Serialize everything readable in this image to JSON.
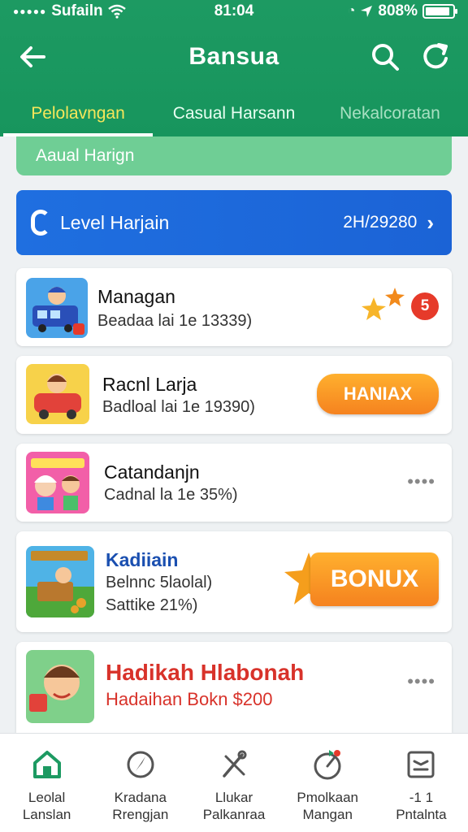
{
  "status": {
    "carrier": "Sufailn",
    "time": "81:04",
    "battery": "808%",
    "battery_level": 0.9
  },
  "header": {
    "title": "Bansua"
  },
  "tabs": [
    {
      "label": "Pelolavngan"
    },
    {
      "label": "Casual Harsann"
    },
    {
      "label": "Nekalcoratan"
    }
  ],
  "subbanner": {
    "label": "Aaual Harign"
  },
  "level": {
    "label": "Level Harjain",
    "code": "2H/29280",
    "chevron": "›"
  },
  "cards": [
    {
      "title": "Managan",
      "subtitle": "Beadaa lai 1e 13339)",
      "badge": "5"
    },
    {
      "title": "Racnl Larja",
      "subtitle": "Badloal lai 1e 19390)",
      "button": "HANIAX"
    },
    {
      "title": "Catandanjn",
      "subtitle": "Cadnal la 1e 35%)",
      "dots": "••••"
    },
    {
      "title": "Kadiiain",
      "subtitle": "Belnnc 5laolal)",
      "subtitle2": "Sattike 21%)",
      "button": "BONUX"
    },
    {
      "title": "Hadikah Hlabonah",
      "subtitle": "Hadaihan Bokn $200",
      "dots": "••••"
    }
  ],
  "nav": [
    {
      "label": "Leolal\nLanslan",
      "icon": "home-icon"
    },
    {
      "label": "Kradana\nRrengjan",
      "icon": "compass-icon"
    },
    {
      "label": "Llukar\nPalkanraa",
      "icon": "tools-icon"
    },
    {
      "label": "Pmolkaan\nMangan",
      "icon": "gauge-icon"
    },
    {
      "label": "-1 1\nPntalnta",
      "icon": "message-icon"
    }
  ],
  "colors": {
    "brand": "#1d9a62",
    "level_bar": "#1f6fe0",
    "accent_orange": "#f5821f",
    "badge_red": "#e63a2a"
  }
}
